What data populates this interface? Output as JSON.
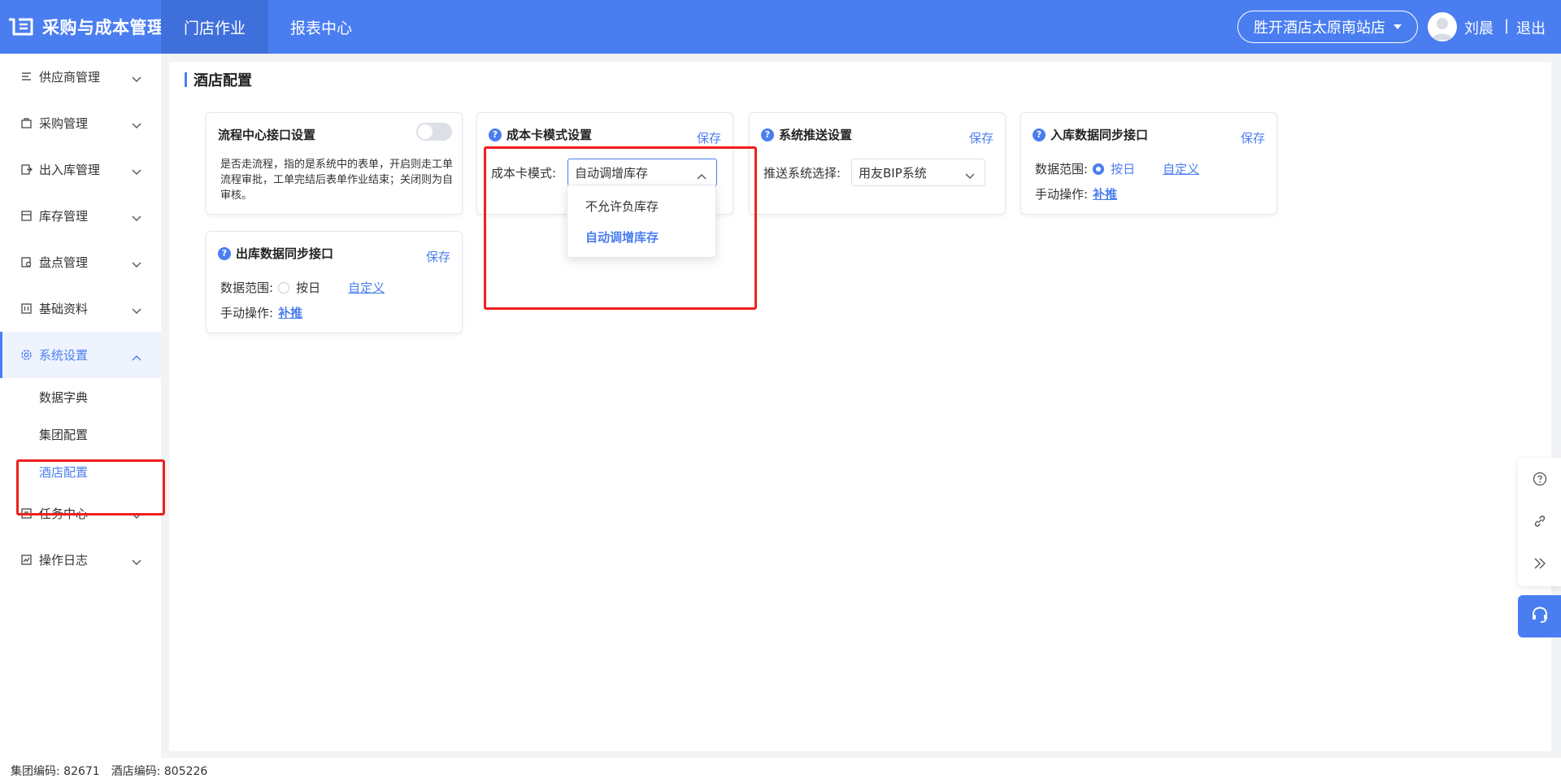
{
  "header": {
    "app_title": "采购与成本管理",
    "tabs": [
      "门店作业",
      "报表中心"
    ],
    "store_name": "胜开酒店太原南站店",
    "user_name": "刘晨",
    "separator": "|",
    "logout": "退出"
  },
  "sidebar": {
    "items": [
      {
        "label": "供应商管理",
        "icon": "supplier-icon"
      },
      {
        "label": "采购管理",
        "icon": "purchase-icon"
      },
      {
        "label": "出入库管理",
        "icon": "inout-icon"
      },
      {
        "label": "库存管理",
        "icon": "inventory-icon"
      },
      {
        "label": "盘点管理",
        "icon": "stocktake-icon"
      },
      {
        "label": "基础资料",
        "icon": "basic-data-icon"
      },
      {
        "label": "系统设置",
        "icon": "gear-icon"
      }
    ],
    "sub_items": [
      "数据字典",
      "集团配置",
      "酒店配置"
    ],
    "items_after": [
      {
        "label": "任务中心",
        "icon": "task-icon"
      },
      {
        "label": "操作日志",
        "icon": "log-icon"
      }
    ]
  },
  "page": {
    "title": "酒店配置"
  },
  "cards": {
    "flow": {
      "title": "流程中心接口设置",
      "description": "是否走流程，指的是系统中的表单，开启则走工单流程审批，工单完结后表单作业结束；关闭则为自审核。",
      "enabled": false
    },
    "cost": {
      "title": "成本卡模式设置",
      "save": "保存",
      "field_label": "成本卡模式:",
      "value": "自动调增库存",
      "options": [
        "不允许负库存",
        "自动调增库存"
      ],
      "selected_option": "自动调增库存"
    },
    "push": {
      "title": "系统推送设置",
      "save": "保存",
      "field_label": "推送系统选择:",
      "value": "用友BIP系统"
    },
    "inbound": {
      "title": "入库数据同步接口",
      "save": "保存",
      "range_label": "数据范围:",
      "option_daily": "按日",
      "option_custom": "自定义",
      "manual_label": "手动操作:",
      "manual_action": "补推"
    },
    "outbound": {
      "title": "出库数据同步接口",
      "save": "保存",
      "range_label": "数据范围:",
      "option_daily": "按日",
      "option_custom": "自定义",
      "manual_label": "手动操作:",
      "manual_action": "补推"
    }
  },
  "footer": {
    "group_code_label": "集团编码:",
    "group_code": "82671",
    "hotel_code_label": "酒店编码:",
    "hotel_code": "805226"
  },
  "colors": {
    "brand": "#4a7ef0",
    "highlight": "#f01f1f"
  }
}
